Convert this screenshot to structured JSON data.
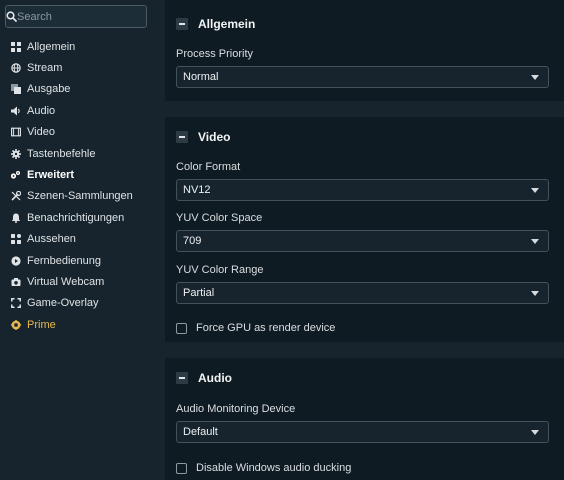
{
  "search": {
    "placeholder": "Search"
  },
  "sidebar": {
    "items": [
      {
        "label": "Allgemein",
        "icon": "grid-icon"
      },
      {
        "label": "Stream",
        "icon": "globe-icon"
      },
      {
        "label": "Ausgabe",
        "icon": "layers-icon"
      },
      {
        "label": "Audio",
        "icon": "speaker-icon"
      },
      {
        "label": "Video",
        "icon": "film-icon"
      },
      {
        "label": "Tastenbefehle",
        "icon": "gear-icon"
      },
      {
        "label": "Erweitert",
        "icon": "cogs-icon",
        "active": true
      },
      {
        "label": "Szenen-Sammlungen",
        "icon": "tools-icon"
      },
      {
        "label": "Benachrichtigungen",
        "icon": "bell-icon"
      },
      {
        "label": "Aussehen",
        "icon": "widgets-icon"
      },
      {
        "label": "Fernbedienung",
        "icon": "play-circle-icon"
      },
      {
        "label": "Virtual Webcam",
        "icon": "camera-icon"
      },
      {
        "label": "Game-Overlay",
        "icon": "expand-icon"
      },
      {
        "label": "Prime",
        "icon": "prime-icon",
        "color": "#e4b94f"
      }
    ]
  },
  "sections": {
    "allgemein": {
      "title": "Allgemein",
      "process_priority": {
        "label": "Process Priority",
        "value": "Normal"
      }
    },
    "video": {
      "title": "Video",
      "color_format": {
        "label": "Color Format",
        "value": "NV12"
      },
      "yuv_color_space": {
        "label": "YUV Color Space",
        "value": "709"
      },
      "yuv_color_range": {
        "label": "YUV Color Range",
        "value": "Partial"
      },
      "force_gpu": {
        "label": "Force GPU as render device",
        "checked": false
      }
    },
    "audio": {
      "title": "Audio",
      "monitoring_device": {
        "label": "Audio Monitoring Device",
        "value": "Default"
      },
      "disable_ducking": {
        "label": "Disable Windows audio ducking",
        "checked": false
      }
    }
  },
  "colors": {
    "background": "#17242d",
    "panel": "#0f1b22",
    "accent_prime": "#e4b94f"
  }
}
